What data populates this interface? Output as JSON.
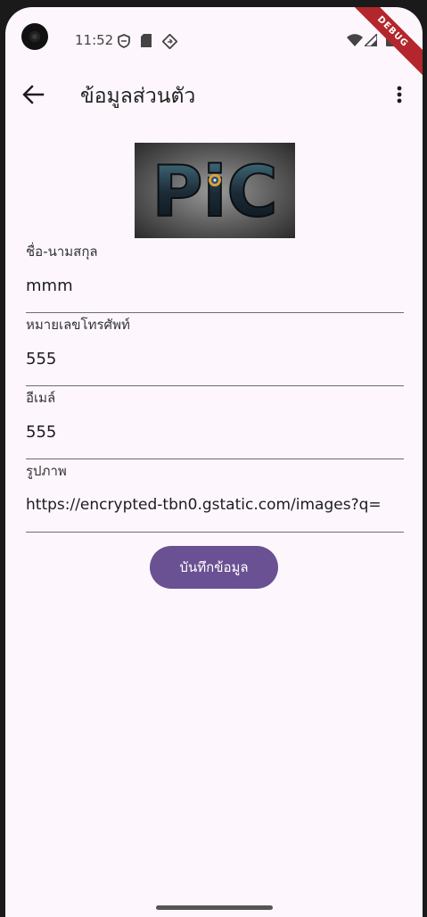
{
  "status_bar": {
    "time": "11:52",
    "icons": [
      "shield-icon",
      "sd-card-icon",
      "location-icon",
      "wifi-icon",
      "signal-icon",
      "battery-icon"
    ]
  },
  "debug_banner": "DEBUG",
  "app_bar": {
    "title": "ข้อมูลส่วนตัว",
    "back_icon": "arrow-back-icon",
    "menu_icon": "more-vert-icon"
  },
  "profile_image": {
    "text": "PiC"
  },
  "form": {
    "fields": [
      {
        "label": "ชื่อ-นามสกุล",
        "value": "mmm"
      },
      {
        "label": "หมายเลขโทรศัพท์",
        "value": "555"
      },
      {
        "label": "อีเมล์",
        "value": "555"
      },
      {
        "label": "รูปภาพ",
        "value": "https://encrypted-tbn0.gstatic.com/images?q="
      }
    ],
    "save_label": "บันทึกข้อมูล"
  },
  "colors": {
    "background": "#fdf7fd",
    "primary_button": "#6a5193",
    "debug_ribbon": "#b3262b"
  }
}
